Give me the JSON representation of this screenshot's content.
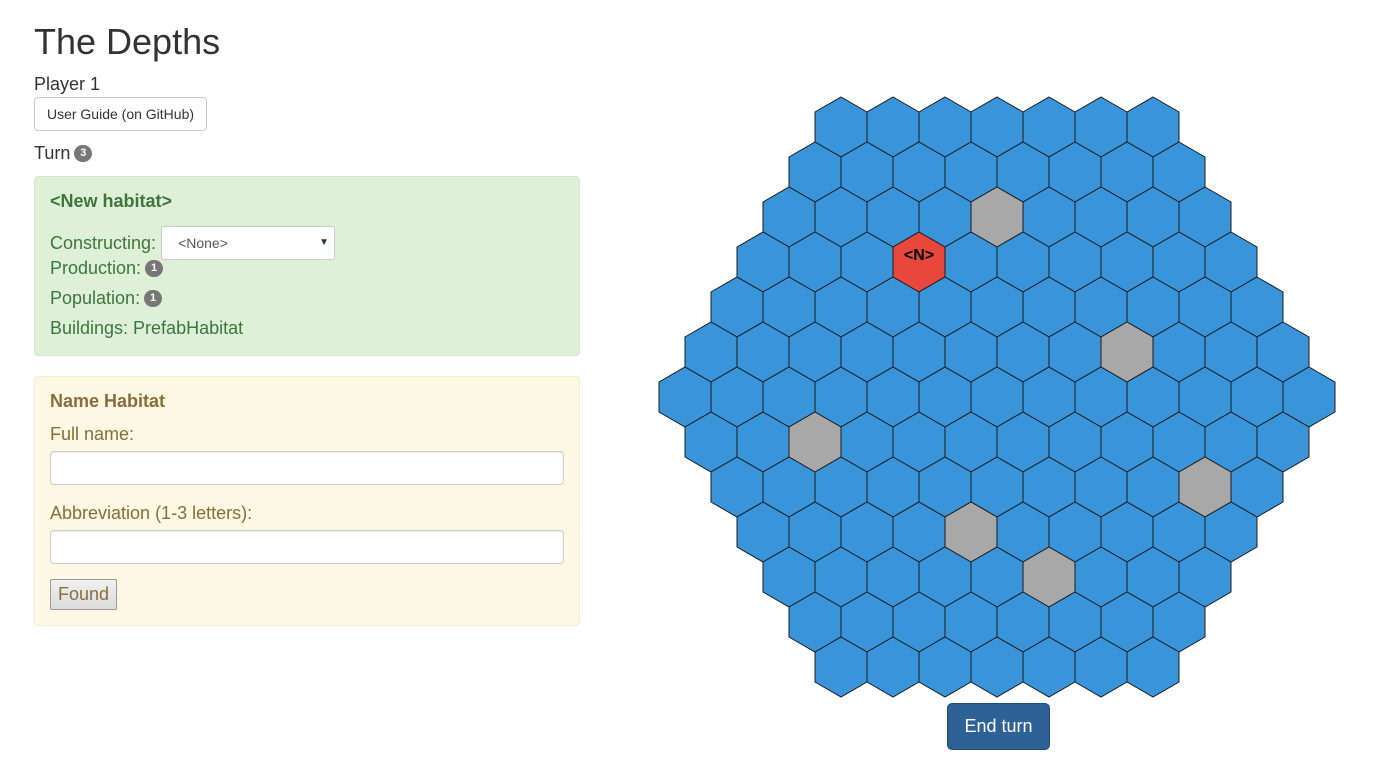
{
  "header": {
    "title": "The Depths",
    "player": "Player 1",
    "guide_button": "User Guide (on GitHub)",
    "turn_label": "Turn",
    "turn_number": "3"
  },
  "habitat": {
    "name": "<New habitat>",
    "constructing_label": "Constructing:",
    "constructing_value": "<None>",
    "production_label": "Production:",
    "production_value": "1",
    "population_label": "Population:",
    "population_value": "1",
    "buildings": "Buildings: PrefabHabitat"
  },
  "name_form": {
    "heading": "Name Habitat",
    "full_name_label": "Full name:",
    "full_name_value": "",
    "abbreviation_label": "Abbreviation (1-3 letters):",
    "abbreviation_value": "",
    "found_button": "Found"
  },
  "map": {
    "rows": [
      7,
      8,
      9,
      10,
      11,
      12,
      13,
      12,
      11,
      10,
      9,
      8,
      7
    ],
    "colors": {
      "water": "#3a94da",
      "rock": "#a8a8a8",
      "habitat": "#e8483b",
      "border": "#1a1a1a"
    },
    "rock_tiles": [
      [
        2,
        4
      ],
      [
        5,
        8
      ],
      [
        7,
        2
      ],
      [
        8,
        9
      ],
      [
        9,
        4
      ],
      [
        10,
        5
      ]
    ],
    "habitat_tiles": [
      {
        "cell": [
          3,
          3
        ],
        "label": "<N>"
      }
    ]
  },
  "end_turn_button": "End turn"
}
